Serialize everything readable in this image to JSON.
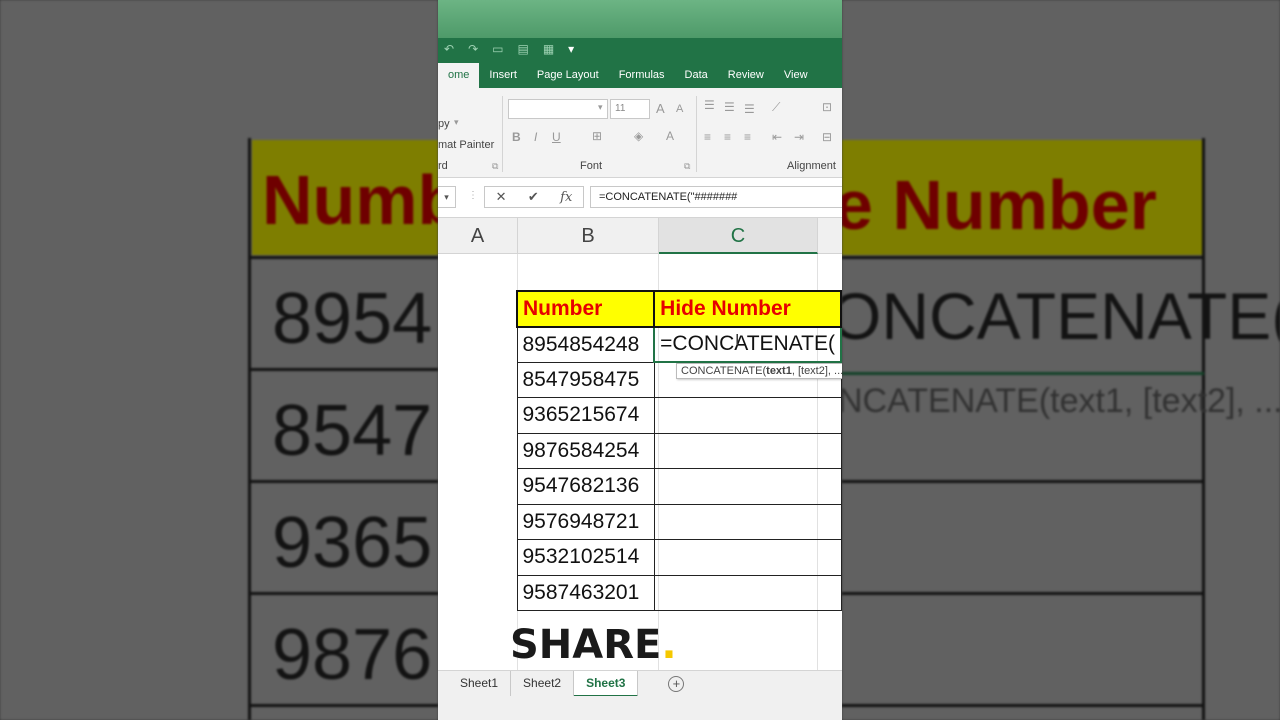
{
  "ribbon_tabs": [
    "ome",
    "Insert",
    "Page Layout",
    "Formulas",
    "Data",
    "Review",
    "View"
  ],
  "ribbon": {
    "clipboard_fragment_1": "py",
    "clipboard_fragment_2": "mat Painter",
    "clipboard_label": "rd",
    "font_group_label": "Font",
    "alignment_group_label": "Alignment",
    "font_size": "11"
  },
  "formula_bar": {
    "cancel_icon": "✕",
    "enter_icon": "✔",
    "fx_icon": "fx",
    "content": "=CONCATENATE(\"#######"
  },
  "columns": [
    "A",
    "B",
    "C"
  ],
  "table": {
    "header_b": "Number",
    "header_c": "Hide Number",
    "editing_value": "=CONCATENATE(",
    "rows": [
      "8954854248",
      "8547958475",
      "9365215674",
      "9876584254",
      "9547682136",
      "9576948721",
      "9532102514",
      "9587463201"
    ]
  },
  "tooltip": {
    "fn": "CONCATENATE(",
    "arg1": "text1",
    "rest": ", [text2], ..."
  },
  "overlay": {
    "share_text": "SHARE",
    "share_dot": "."
  },
  "sheets": [
    "Sheet1",
    "Sheet2",
    "Sheet3"
  ],
  "active_sheet": "Sheet3",
  "background_left": {
    "title_fragment": "Numb",
    "numbers": [
      "8954",
      "8547",
      "9365",
      "9876"
    ]
  },
  "background_right": {
    "title_fragment": "e Number",
    "formula_fragment": "ONCATENATE(",
    "tooltip_fragment": "NCATENATE(text1, [text2], ..."
  },
  "colors": {
    "excel_green": "#217346",
    "header_yellow": "#ffff00",
    "header_red": "#e60000"
  }
}
